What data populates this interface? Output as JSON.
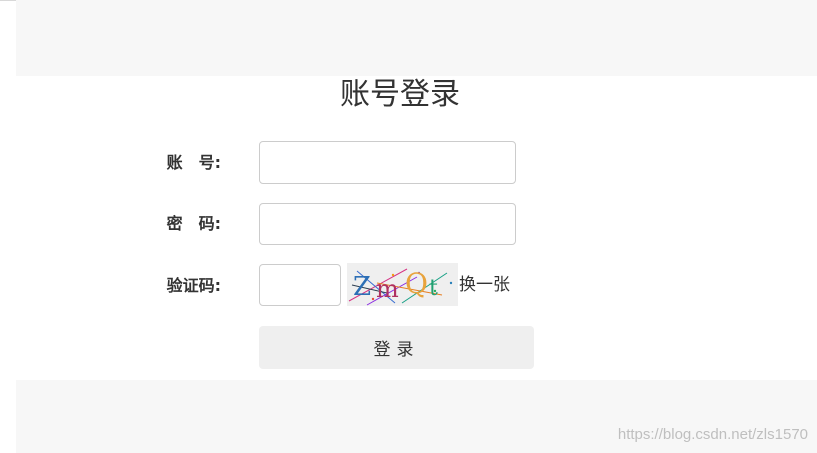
{
  "page": {
    "title": "账号登录"
  },
  "form": {
    "username_label": "账　号:",
    "password_label": "密　码:",
    "captcha_label": "验证码:",
    "username_value": "",
    "password_value": "",
    "captcha_value": "",
    "captcha_text": "ZmQt",
    "change_captcha_label": "换一张",
    "login_button_label": "登录"
  },
  "footer": {
    "watermark": "https://blog.csdn.net/zls1570"
  }
}
